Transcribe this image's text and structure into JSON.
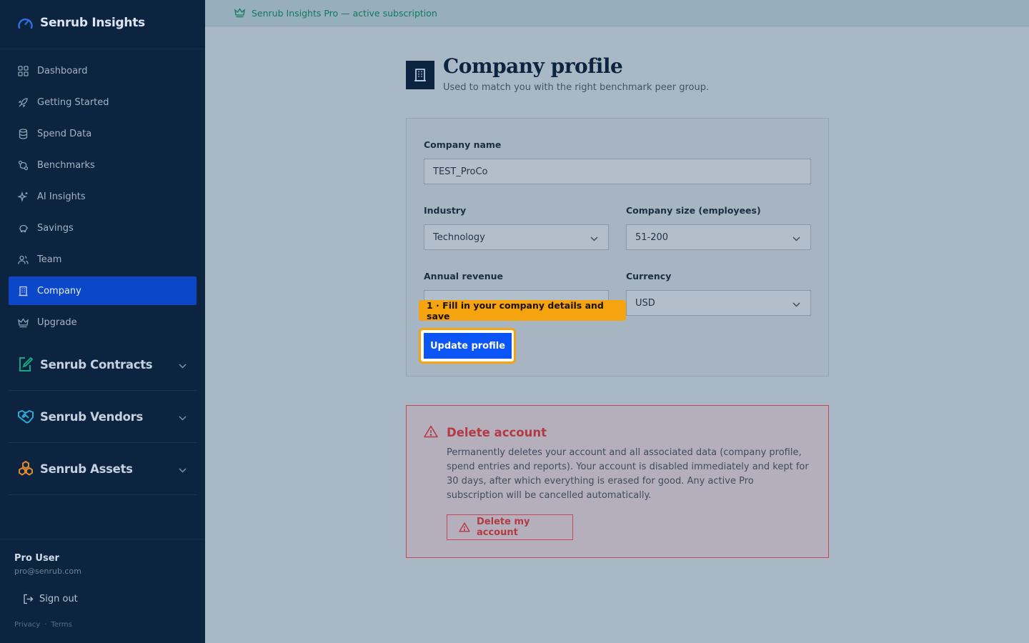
{
  "brand": {
    "name": "Senrub Insights"
  },
  "nav": [
    {
      "label": "Dashboard",
      "icon": "dashboard-icon"
    },
    {
      "label": "Getting Started",
      "icon": "rocket-icon"
    },
    {
      "label": "Spend Data",
      "icon": "database-icon"
    },
    {
      "label": "Benchmarks",
      "icon": "benchmarks-icon"
    },
    {
      "label": "AI Insights",
      "icon": "sparkles-icon"
    },
    {
      "label": "Savings",
      "icon": "piggy-bank-icon"
    },
    {
      "label": "Team",
      "icon": "users-icon"
    },
    {
      "label": "Company",
      "icon": "building-icon",
      "active": true
    },
    {
      "label": "Upgrade",
      "icon": "crown-icon"
    }
  ],
  "groups": [
    {
      "label": "Senrub Contracts",
      "icon": "contract-pen-icon"
    },
    {
      "label": "Senrub Vendors",
      "icon": "handshake-icon"
    },
    {
      "label": "Senrub Assets",
      "icon": "assets-boxes-icon"
    }
  ],
  "user": {
    "name": "Pro User",
    "email": "pro@senrub.com"
  },
  "signout_label": "Sign out",
  "legal": {
    "privacy": "Privacy",
    "separator": "·",
    "terms": "Terms"
  },
  "banner": {
    "text": "Senrub Insights Pro — active subscription"
  },
  "page": {
    "title": "Company profile",
    "subtitle": "Used to match you with the right benchmark peer group."
  },
  "form": {
    "company_name_label": "Company name",
    "company_name_value": "TEST_ProCo",
    "industry_label": "Industry",
    "industry_value": "Technology",
    "size_label": "Company size (employees)",
    "size_value": "51-200",
    "revenue_label": "Annual revenue",
    "currency_label": "Currency",
    "currency_value": "USD",
    "update_button": "Update profile"
  },
  "tooltip": {
    "text": "1 · Fill in your company details and save"
  },
  "danger": {
    "title": "Delete account",
    "text": "Permanently deletes your account and all associated data (company profile, spend entries and reports). Your account is disabled immediately and kept for 30 days, after which everything is erased for good. Any active Pro subscription will be cancelled automatically.",
    "button": "Delete my account"
  },
  "colors": {
    "sidebar": "#0c2440",
    "active_nav": "#0d47c9",
    "primary_button": "#0b54f5",
    "tooltip": "#f5a30f",
    "danger": "#b33a45",
    "banner_text": "#0f7a5a"
  }
}
